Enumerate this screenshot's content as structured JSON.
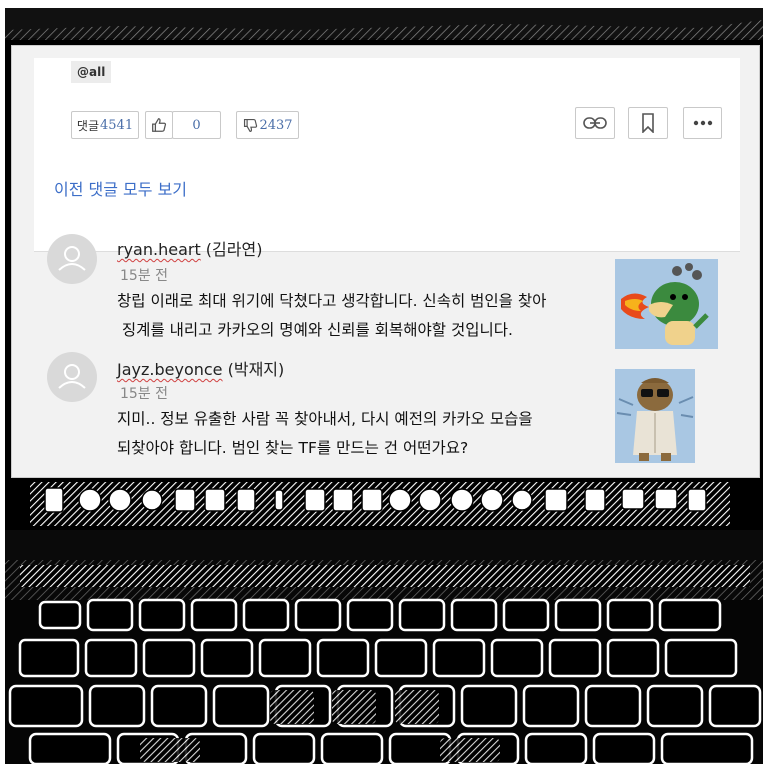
{
  "post": {
    "tag": "@all",
    "comment_label": "댓글",
    "comment_count": "4541",
    "like_count": "0",
    "dislike_count": "2437",
    "icons": [
      "thumbs-up-icon",
      "thumbs-down-icon",
      "link-icon",
      "bookmark-icon",
      "more-icon"
    ]
  },
  "view_previous_label": "이전 댓글 모두 보기",
  "comments": [
    {
      "username": "ryan.heart",
      "realname": " (김라연)",
      "time": "15분 전",
      "text": "창립 이래로 최대 위기에 닥쳤다고 생각합니다. 신속히 범인을 찾아\n 징계를 내리고 카카오의 명예와 신뢰를 회복해야할 것입니다."
    },
    {
      "username": "Jayz.beyonce",
      "realname": " (박재지)",
      "time": "15분 전",
      "text": "지미.. 정보 유출한 사람 꼭 찾아내서, 다시 예전의 카카오 모습을\n되찾아야 합니다. 범인 찾는 TF를 만드는 건 어떤가요?"
    }
  ],
  "colors": {
    "link": "#3c6ec8",
    "counter": "#4a6ea8",
    "thumb_bg": "#a9c7e3"
  }
}
